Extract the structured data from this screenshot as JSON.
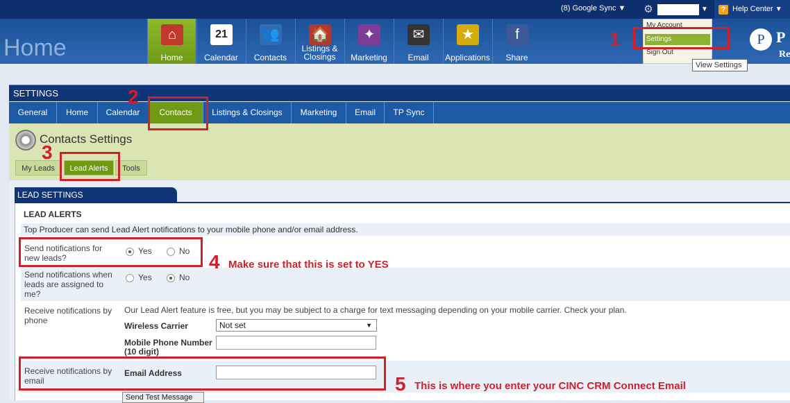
{
  "topbar": {
    "google_sync": "(8) Google Sync ▼",
    "help_center": "Help Center",
    "help_icon": "?"
  },
  "header": {
    "title": "Home",
    "nav": [
      {
        "label": "Home",
        "icon": "house-icon",
        "color": "#c0392b",
        "glyph": "⌂"
      },
      {
        "label": "Calendar",
        "icon": "calendar-icon",
        "color": "#ffffff",
        "glyph": "21"
      },
      {
        "label": "Contacts",
        "icon": "people-icon",
        "color": "#2f6cb3",
        "glyph": "👥"
      },
      {
        "label": "Listings & Closings",
        "icon": "sold-sign-icon",
        "color": "#b03a2e",
        "glyph": "🏠"
      },
      {
        "label": "Marketing",
        "icon": "puzzle-icon",
        "color": "#7d3c98",
        "glyph": "✦"
      },
      {
        "label": "Email",
        "icon": "mailbox-icon",
        "color": "#333333",
        "glyph": "✉"
      },
      {
        "label": "Applications",
        "icon": "apps-icon",
        "color": "#d4ac0d",
        "glyph": "★"
      },
      {
        "label": "Share",
        "icon": "share-icon",
        "color": "#3b5998",
        "glyph": "f"
      }
    ],
    "logo_letter": "P",
    "logo_text": "P",
    "logo_sub": "Re"
  },
  "dropdown": {
    "items": [
      "My Account",
      "Settings",
      "Sign Out"
    ],
    "tooltip": "View Settings"
  },
  "settings": {
    "bar_title": "SETTINGS",
    "tabs": [
      "General",
      "Home",
      "Calendar",
      "Contacts",
      "Listings & Closings",
      "Marketing",
      "Email",
      "TP Sync"
    ],
    "section_title": "Contacts Settings",
    "subtabs": [
      "My Leads",
      "Lead Alerts",
      "Tools"
    ]
  },
  "lead": {
    "header": "LEAD SETTINGS",
    "title": "LEAD ALERTS",
    "desc": "Top Producer can send Lead Alert notifications to your mobile phone and/or email address.",
    "q1": "Send notifications for new leads?",
    "q2": "Send notifications when leads are assigned to me?",
    "q3": "Receive notifications by phone",
    "q4": "Receive notifications by email",
    "yes": "Yes",
    "no": "No",
    "q1_value": "Yes",
    "q2_value": "No",
    "phone_note": "Our Lead Alert feature is free, but you may be subject to a charge for text messaging depending on your mobile carrier. Check your plan.",
    "carrier_label": "Wireless Carrier",
    "carrier_value": "Not set",
    "mobile_label": "Mobile Phone Number (10 digit)",
    "email_label": "Email Address",
    "email_value": "",
    "test_button": "Send Test Message"
  },
  "annotations": {
    "n1": "1",
    "n2": "2",
    "n3": "3",
    "n4": "4",
    "n5": "5",
    "note4": "Make sure that this is set to YES",
    "note5": "This is where you enter your  CINC CRM Connect Email",
    "color": "#d0202a"
  }
}
